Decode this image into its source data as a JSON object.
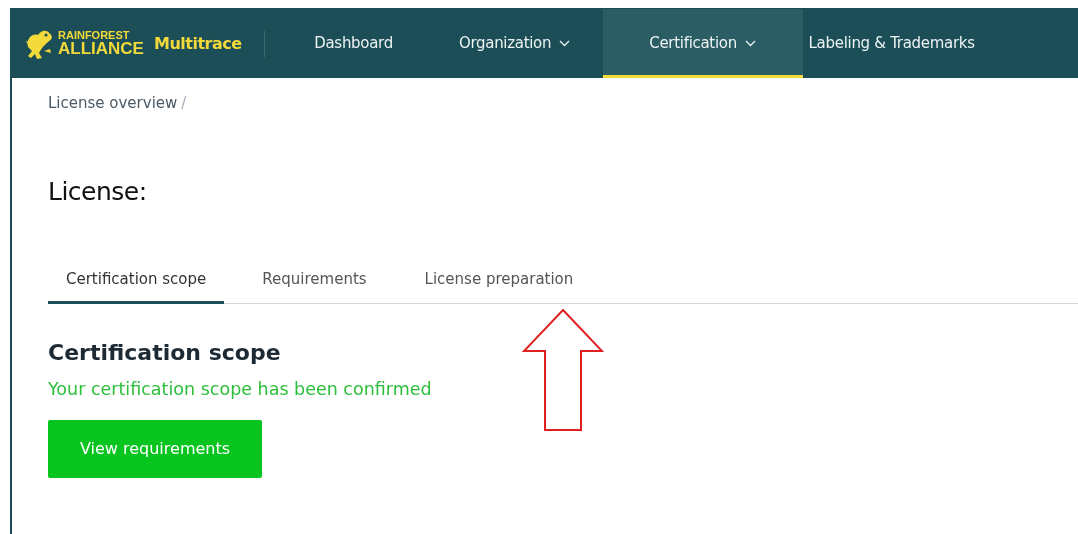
{
  "brand": {
    "logo_line_1": "RAINFOREST",
    "logo_line_2": "ALLIANCE",
    "app_name": "Multitrace"
  },
  "nav": [
    {
      "label": "Dashboard",
      "dropdown": false,
      "selected": false
    },
    {
      "label": "Organization",
      "dropdown": true,
      "selected": false
    },
    {
      "label": "Certification",
      "dropdown": true,
      "selected": true
    },
    {
      "label": "Labeling & Trademarks",
      "dropdown": false,
      "selected": false
    }
  ],
  "breadcrumb": [
    {
      "label": "License overview",
      "separator": "/"
    }
  ],
  "page_title": "License:",
  "tabs": [
    {
      "label": "Certification scope",
      "selected": true
    },
    {
      "label": "Requirements",
      "selected": false
    },
    {
      "label": "License preparation",
      "selected": false
    }
  ],
  "section": {
    "title": "Certification scope",
    "status": "Your certification scope has been confirmed",
    "button": "View requirements"
  }
}
